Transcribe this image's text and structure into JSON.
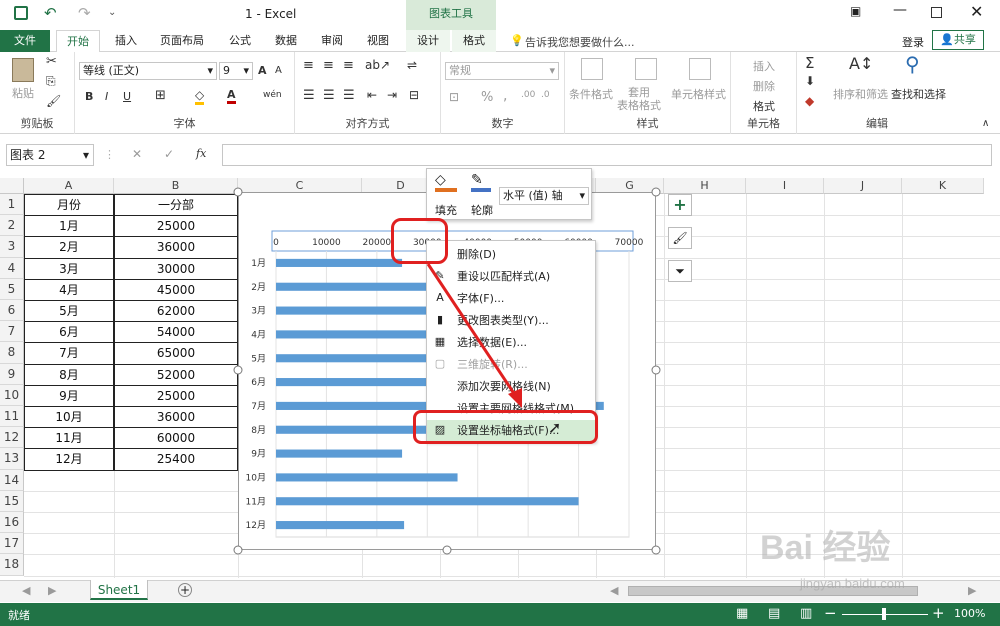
{
  "title_bar": {
    "doc_title": "1 - Excel",
    "context_tools": "图表工具"
  },
  "tabs": [
    "文件",
    "开始",
    "插入",
    "页面布局",
    "公式",
    "数据",
    "审阅",
    "视图",
    "设计",
    "格式"
  ],
  "tell_me": "告诉我您想要做什么...",
  "login": "登录",
  "share": "共享",
  "ribbon": {
    "clipboard": {
      "paste": "粘贴",
      "label": "剪贴板"
    },
    "font": {
      "name": "等线 (正文)",
      "size": "9",
      "bold": "B",
      "italic": "I",
      "underline": "U",
      "grow": "A",
      "shrink": "A",
      "color": "A",
      "label": "字体"
    },
    "align": {
      "label": "对齐方式"
    },
    "number": {
      "format": "常规",
      "percent": "%",
      "comma": ",",
      "label": "数字"
    },
    "styles": {
      "cond": "条件格式",
      "table": "套用\n表格格式",
      "cell": "单元格样式",
      "label": "样式"
    },
    "cells": {
      "insert": "插入",
      "delete": "删除",
      "format": "格式",
      "label": "单元格"
    },
    "edit": {
      "sort": "排序和筛选",
      "find": "查找和选择",
      "label": "编辑"
    }
  },
  "formula_bar": {
    "name_box": "图表 2",
    "fx": "fx",
    "value": ""
  },
  "columns": [
    "A",
    "B",
    "C",
    "D",
    "E",
    "F",
    "G",
    "H",
    "I",
    "J",
    "K"
  ],
  "rows": [
    "1",
    "2",
    "3",
    "4",
    "5",
    "6",
    "7",
    "8",
    "9",
    "10",
    "11",
    "12",
    "13",
    "14",
    "15",
    "16",
    "17",
    "18"
  ],
  "table": {
    "headers": [
      "月份",
      "一分部"
    ],
    "rows": [
      [
        "1月",
        "25000"
      ],
      [
        "2月",
        "36000"
      ],
      [
        "3月",
        "30000"
      ],
      [
        "4月",
        "45000"
      ],
      [
        "5月",
        "62000"
      ],
      [
        "6月",
        "54000"
      ],
      [
        "7月",
        "65000"
      ],
      [
        "8月",
        "52000"
      ],
      [
        "9月",
        "25000"
      ],
      [
        "10月",
        "36000"
      ],
      [
        "11月",
        "60000"
      ],
      [
        "12月",
        "25400"
      ]
    ]
  },
  "chart_data": {
    "type": "bar",
    "orientation": "horizontal",
    "categories": [
      "1月",
      "2月",
      "3月",
      "4月",
      "5月",
      "6月",
      "7月",
      "8月",
      "9月",
      "10月",
      "11月",
      "12月"
    ],
    "values": [
      25000,
      36000,
      30000,
      45000,
      62000,
      54000,
      65000,
      52000,
      25000,
      36000,
      60000,
      25400
    ],
    "xticks": [
      "0",
      "10000",
      "20000",
      "30000",
      "40000",
      "50000",
      "60000",
      "70000"
    ],
    "xlim": [
      0,
      70000
    ],
    "axis_position": "top",
    "bar_color": "#5b9bd5",
    "title": "",
    "xlabel": "",
    "ylabel": ""
  },
  "format_popup": {
    "fill": "填充",
    "outline": "轮廓",
    "selector": "水平 (值) 轴"
  },
  "context_menu": [
    "删除(D)",
    "重设以匹配样式(A)",
    "字体(F)...",
    "更改图表类型(Y)...",
    "选择数据(E)...",
    "三维旋转(R)...",
    "添加次要网格线(N)",
    "设置主要网格线格式(M)...",
    "设置坐标轴格式(F)..."
  ],
  "context_menu_disabled": [
    false,
    false,
    false,
    false,
    false,
    true,
    false,
    false,
    false
  ],
  "sheet_tab": "Sheet1",
  "status": {
    "ready": "就绪",
    "zoom": "100%"
  },
  "watermark": {
    "brand": "Bai  经验",
    "url": "jingyan.baidu.com"
  },
  "colors": {
    "excel_green": "#217346",
    "highlight_red": "#e02020",
    "bar_blue": "#5b9bd5"
  }
}
